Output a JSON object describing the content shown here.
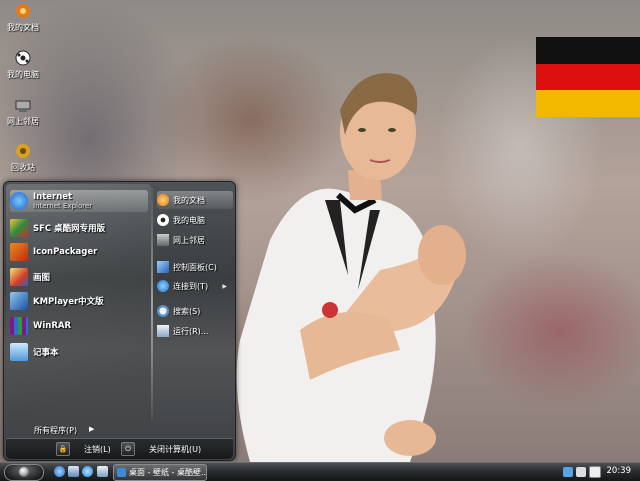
{
  "desktop": {
    "icons": [
      {
        "label": "我的文档",
        "icon": "my-documents-icon"
      },
      {
        "label": "我的电脑",
        "icon": "my-computer-icon"
      },
      {
        "label": "网上邻居",
        "icon": "network-places-icon"
      },
      {
        "label": "回收站",
        "icon": "recycle-bin-icon"
      }
    ]
  },
  "start_menu": {
    "pinned": [
      {
        "label": "Internet",
        "sublabel": "Internet Explorer",
        "icon": "internet-explorer-icon"
      },
      {
        "label": "SFC 桌酷网专用版",
        "icon": "sfc-app-icon"
      },
      {
        "label": "IconPackager",
        "icon": "iconpackager-icon"
      },
      {
        "label": "画图",
        "icon": "paint-icon"
      },
      {
        "label": "KMPlayer中文版",
        "icon": "kmplayer-icon"
      },
      {
        "label": "WinRAR",
        "icon": "winrar-icon"
      },
      {
        "label": "记事本",
        "icon": "notepad-icon"
      }
    ],
    "places": [
      {
        "label": "我的文档",
        "icon": "my-documents-icon"
      },
      {
        "label": "我的电脑",
        "icon": "my-computer-icon"
      },
      {
        "label": "网上邻居",
        "icon": "network-places-icon"
      },
      {
        "label": "控制面板(C)",
        "icon": "control-panel-icon"
      },
      {
        "label": "连接到(T)",
        "icon": "connect-to-icon"
      },
      {
        "label": "搜索(S)",
        "icon": "search-icon"
      },
      {
        "label": "运行(R)...",
        "icon": "run-icon"
      }
    ],
    "all_programs": "所有程序(P)",
    "logoff": "注销(L)",
    "shutdown": "关闭计算机(U)"
  },
  "taskbar": {
    "task_label": "桌面 - 壁纸 - 桌酷壁...",
    "clock": "20:39"
  },
  "colors": {
    "flag_black": "#111111",
    "flag_red": "#dd1010",
    "flag_gold": "#f2b800",
    "accent_blue": "#3a8bd8"
  }
}
